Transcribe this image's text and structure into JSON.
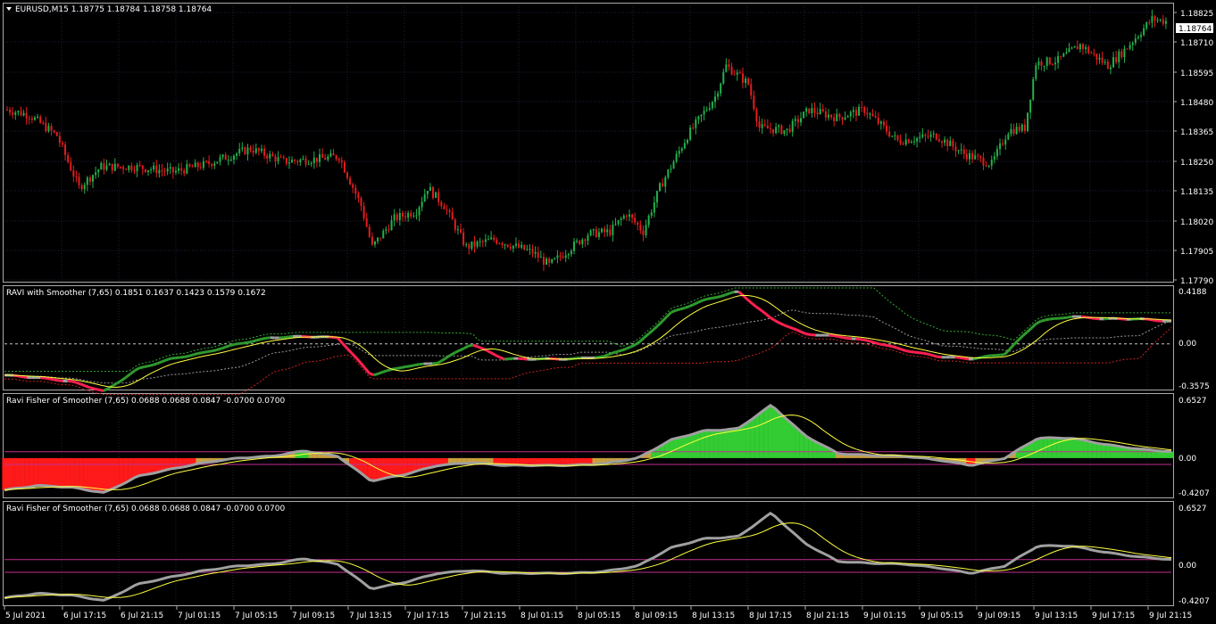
{
  "main": {
    "title": "EURUSD,M15  1.18775 1.18784 1.18758 1.18764",
    "current_price": "1.18764",
    "price_ticks": [
      "1.18825",
      "1.18710",
      "1.18595",
      "1.18480",
      "1.18365",
      "1.18250",
      "1.18135",
      "1.18020",
      "1.17905",
      "1.17790"
    ]
  },
  "panel1": {
    "title": "RAVI with Smoother (7,65) 0.1851 0.1637 0.1423 0.1579 0.1672",
    "ticks": [
      "0.4188",
      "0.00",
      "-0.3575"
    ]
  },
  "panel2": {
    "title": "Ravi Fisher of Smoother  (7,65) 0.0688 0.0688 0.0847 -0.0700 0.0700",
    "ticks": [
      "0.6527",
      "0.00",
      "-0.4207"
    ]
  },
  "panel3": {
    "title": "Ravi Fisher of Smoother  (7,65) 0.0688 0.0688 0.0847 -0.0700 0.0700",
    "ticks": [
      "0.6527",
      "0.00",
      "-0.4207"
    ]
  },
  "time_axis": [
    "5 Jul 2021",
    "6 Jul 17:15",
    "6 Jul 21:15",
    "7 Jul 01:15",
    "7 Jul 05:15",
    "7 Jul 09:15",
    "7 Jul 13:15",
    "7 Jul 17:15",
    "7 Jul 21:15",
    "8 Jul 01:15",
    "8 Jul 05:15",
    "8 Jul 09:15",
    "8 Jul 13:15",
    "8 Jul 17:15",
    "8 Jul 21:15",
    "9 Jul 01:15",
    "9 Jul 05:15",
    "9 Jul 09:15",
    "9 Jul 13:15",
    "9 Jul 17:15",
    "9 Jul 21:15"
  ],
  "colors": {
    "bull": "#22b14c",
    "bear": "#e21d1d",
    "grid": "#1e1e3c",
    "ravi_up": "#2e9a2e",
    "ravi_down": "#ff2050",
    "ravi_flat": "#a0a0a0",
    "signal": "#ffff40",
    "fill_up": "#33cc33",
    "fill_down": "#ff1a1a",
    "fill_flat": "#c8a040",
    "level": "#c03090"
  },
  "chart_data": {
    "type": "candlestick",
    "symbol": "EURUSD",
    "timeframe": "M15",
    "price_path_anchors": [
      [
        0,
        1.1845
      ],
      [
        8,
        1.1843
      ],
      [
        18,
        1.1835
      ],
      [
        26,
        1.1815
      ],
      [
        34,
        1.1823
      ],
      [
        46,
        1.1823
      ],
      [
        60,
        1.1821
      ],
      [
        72,
        1.1824
      ],
      [
        88,
        1.183
      ],
      [
        100,
        1.1825
      ],
      [
        112,
        1.1826
      ],
      [
        120,
        1.1827
      ],
      [
        128,
        1.1808
      ],
      [
        132,
        1.1792
      ],
      [
        140,
        1.1803
      ],
      [
        148,
        1.1806
      ],
      [
        152,
        1.1815
      ],
      [
        158,
        1.1808
      ],
      [
        166,
        1.1792
      ],
      [
        176,
        1.1795
      ],
      [
        190,
        1.179
      ],
      [
        196,
        1.1785
      ],
      [
        210,
        1.1797
      ],
      [
        218,
        1.1798
      ],
      [
        224,
        1.1805
      ],
      [
        230,
        1.1798
      ],
      [
        236,
        1.1815
      ],
      [
        246,
        1.1835
      ],
      [
        256,
        1.185
      ],
      [
        260,
        1.1862
      ],
      [
        268,
        1.1855
      ],
      [
        272,
        1.1838
      ],
      [
        282,
        1.1837
      ],
      [
        290,
        1.1845
      ],
      [
        300,
        1.1842
      ],
      [
        310,
        1.1845
      ],
      [
        322,
        1.1833
      ],
      [
        336,
        1.1835
      ],
      [
        346,
        1.1828
      ],
      [
        356,
        1.1824
      ],
      [
        362,
        1.1837
      ],
      [
        368,
        1.1838
      ],
      [
        372,
        1.1863
      ],
      [
        380,
        1.1864
      ],
      [
        388,
        1.187
      ],
      [
        398,
        1.1862
      ],
      [
        404,
        1.1868
      ],
      [
        414,
        1.188
      ],
      [
        420,
        1.1879
      ]
    ],
    "indicators": [
      {
        "name": "RAVI with Smoother",
        "period": [
          7,
          65
        ],
        "values": [
          0.1851,
          0.1637,
          0.1423,
          0.1579,
          0.1672
        ],
        "range": [
          -0.3575,
          0.4188
        ]
      },
      {
        "name": "Ravi Fisher of Smoother",
        "period": [
          7,
          65
        ],
        "values": [
          0.0688,
          0.0688,
          0.0847,
          -0.07,
          0.07
        ],
        "range": [
          -0.4207,
          0.6527
        ]
      }
    ]
  }
}
